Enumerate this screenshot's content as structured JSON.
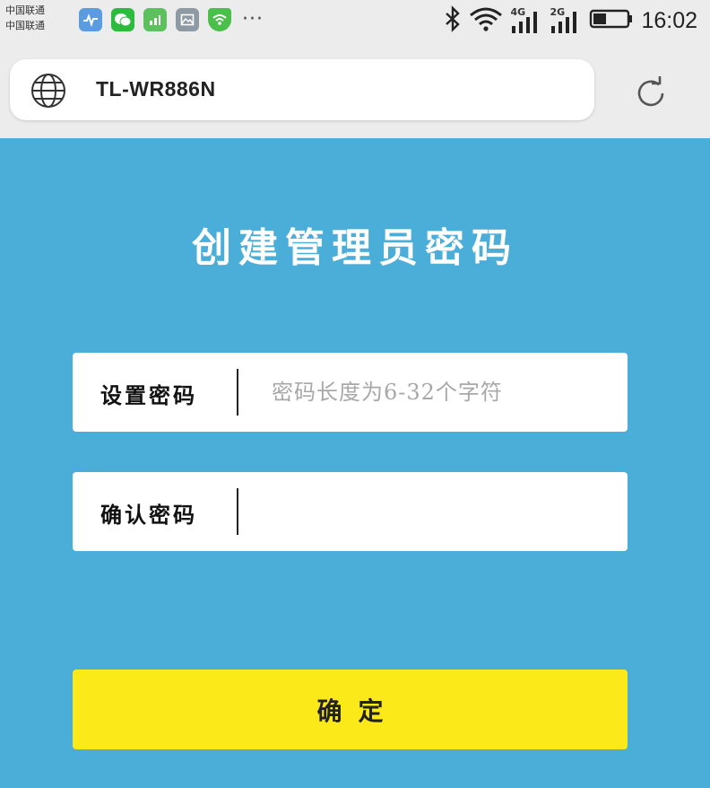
{
  "status_bar": {
    "carrier_1": "中国联通",
    "carrier_2": "中国联通",
    "notification_icons": [
      "health-app-icon",
      "wechat-icon",
      "data-monitor-icon",
      "gallery-icon",
      "wifi-shield-icon"
    ],
    "more": "···",
    "network_1": "4G",
    "network_2": "2G",
    "time": "16:02",
    "battery_level": 0.4
  },
  "browser": {
    "url": "TL-WR886N"
  },
  "page": {
    "title": "创建管理员密码",
    "set_password": {
      "label": "设置密码",
      "placeholder": "密码长度为6-32个字符",
      "value": ""
    },
    "confirm_password": {
      "label": "确认密码",
      "placeholder": "",
      "value": ""
    },
    "confirm_button": "确定"
  },
  "colors": {
    "page_background": "#4aaed8",
    "button": "#fbe91a",
    "chrome": "#ececec"
  }
}
